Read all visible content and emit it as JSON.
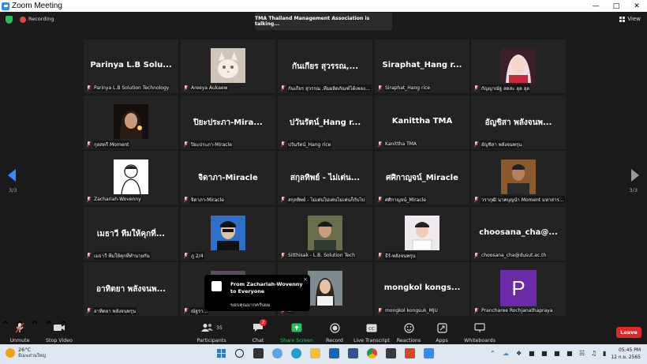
{
  "window": {
    "title": "Zoom Meeting"
  },
  "topbar": {
    "recording_label": "Recording",
    "talking": "TMA Thailand Management Association is talking...",
    "view_label": "View"
  },
  "colors": {
    "accent": "#2d8cff",
    "mic_muted": "#e5463b",
    "leave": "#e02828",
    "share": "#23c05a"
  },
  "gallery": {
    "page_left": "3/3",
    "page_right": "3/3",
    "tiles": [
      {
        "name": "Parinya L.B Solu...",
        "label": "Parinya L.B Solution Technology"
      },
      {
        "name": "",
        "label": "Areeya Aukaew",
        "photo": "cat"
      },
      {
        "name": "กันเกียร สุวรรณ,...",
        "label": "กันเกียร สุวรรณ ,ทีมผลิตภัณฑ์ได้เพลงค่ะ"
      },
      {
        "name": "Siraphat_Hang r...",
        "label": "Siraphat_Hang rice"
      },
      {
        "name": "",
        "label": "กัญญาณัฐ สดสะ ลุล ลุล",
        "photo": "anime"
      },
      {
        "name": "",
        "label": "กุลสตรี Moment",
        "photo": "girl"
      },
      {
        "name": "ปิยะประภา-Mira...",
        "label": "ปิยะประภา-Miracle"
      },
      {
        "name": "ปวันรัตน์_Hang r...",
        "label": "ปวันรัตน์_Hang rice"
      },
      {
        "name": "Kanittha TMA",
        "label": "Kanittha TMA"
      },
      {
        "name": "อัญชิสา พลังจนพ...",
        "label": "อัญชิสา พลังจนพรุน"
      },
      {
        "name": "",
        "label": "Zachariah-Wovenny",
        "photo": "sketch"
      },
      {
        "name": "จิดาภา-Miracle",
        "label": "จิดาภา-Miracle"
      },
      {
        "name": "สกุลทิพย์ - ไม่เต่น...",
        "label": "สกุลทิพย์ - ไม่เต่นไม่เต่นไม่เต่นก็กับไป"
      },
      {
        "name": "ศศิกาญจน์_Miracle",
        "label": "ศศิกาญจน์_Miracle"
      },
      {
        "name": "",
        "label": "วรากุฒิ นาคบุญนำ Moment มหาสารค...",
        "photo": "boy"
      },
      {
        "name": "เมธาวี ทีมให้คุกที่...",
        "label": "เมธาวี ทีมให้คุกที่ทำนายกัน"
      },
      {
        "name": "",
        "label": "ภู 2/4",
        "photo": "mask"
      },
      {
        "name": "",
        "label": "Sitthisak - L.B. Solution Tech",
        "photo": "man"
      },
      {
        "name": "",
        "label": "ธีร์-พลังจนพรุน",
        "photo": "portrait"
      },
      {
        "name": "choosana_cha@...",
        "label": "choosana_cha@dusut.ac.th"
      },
      {
        "name": "อาทิตยา พลังจนพ...",
        "label": "อาทิตยา พลังจนพรุน"
      },
      {
        "name": "",
        "label": "ณัฐรา...",
        "photo": "dark"
      },
      {
        "name": "",
        "label": "...",
        "photo": "woman"
      },
      {
        "name": "mongkol kongs...",
        "label": "mongkol kongsuk_MJU"
      },
      {
        "name": "",
        "label": "Prancharee Rochjanathapraya",
        "avatar_letter": "P"
      }
    ]
  },
  "toast": {
    "from": "From Zachariah-Wovenny to Everyone",
    "message": "ขอบคุณมากครับผม",
    "close": "×"
  },
  "controls": {
    "unmute": "Unmute",
    "stop_video": "Stop Video",
    "participants": "Participants",
    "participants_count": "35",
    "chat": "Chat",
    "chat_badge": "2",
    "share_screen": "Share Screen",
    "record": "Record",
    "live_transcript": "Live Transcript",
    "reactions": "Reactions",
    "apps": "Apps",
    "whiteboards": "Whiteboards",
    "leave": "Leave"
  },
  "taskbar": {
    "temp": "26°C",
    "weather_desc": "มีเมฆส่วนใหญ่",
    "time": "05:45 PM",
    "date": "12 ก.ย. 2565"
  }
}
